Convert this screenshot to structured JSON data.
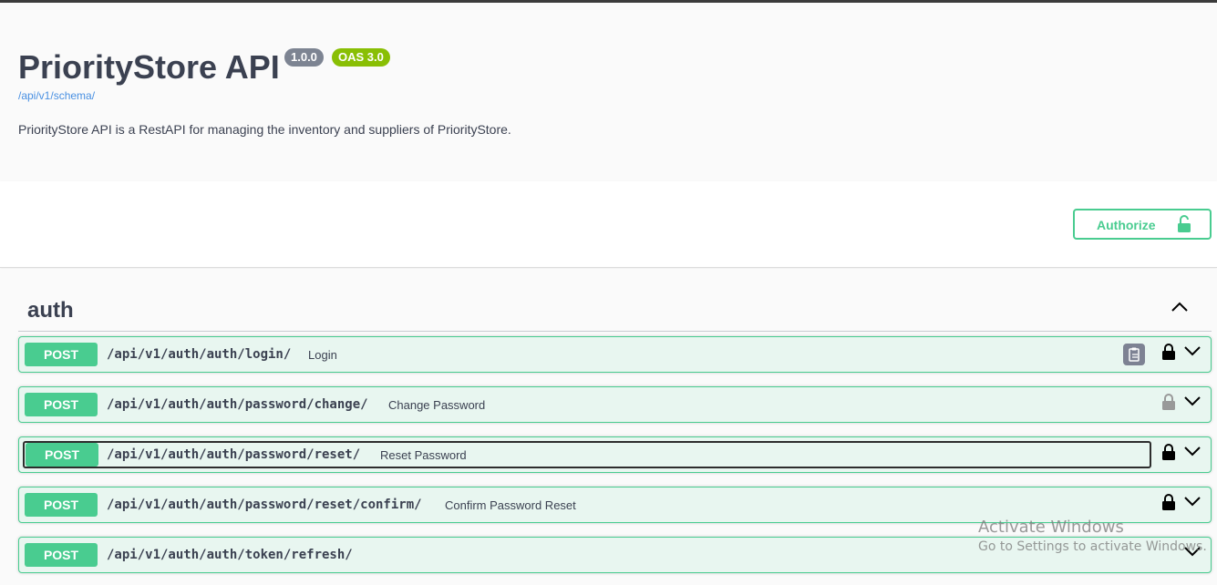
{
  "info": {
    "title": "PriorityStore API",
    "version_badge": "1.0.0",
    "oas_badge": "OAS 3.0",
    "schema_link": "/api/v1/schema/",
    "description": "PriorityStore API is a RestAPI for managing the inventory and suppliers of PriorityStore."
  },
  "authorize": {
    "label": "Authorize",
    "icon": "unlock-icon"
  },
  "tag": {
    "name": "auth",
    "expanded": true
  },
  "operations": [
    {
      "method": "POST",
      "path": "/api/v1/auth/auth/login/",
      "summary": "Login",
      "locked": true
    },
    {
      "method": "POST",
      "path": "/api/v1/auth/auth/password/change/",
      "summary": "Change Password",
      "locked": true
    },
    {
      "method": "POST",
      "path": "/api/v1/auth/auth/password/reset/",
      "summary": "Reset Password",
      "locked": true
    },
    {
      "method": "POST",
      "path": "/api/v1/auth/auth/password/reset/confirm/",
      "summary": "Confirm Password Reset",
      "locked": true
    },
    {
      "method": "POST",
      "path": "/api/v1/auth/auth/token/refresh/",
      "summary": "",
      "locked": false
    }
  ],
  "colors": {
    "post": "#49cc90",
    "post_bg": "#e8f6f0",
    "text": "#3b4151",
    "link": "#4990e2",
    "badge_gray": "#7d8492",
    "badge_green": "#89bf04"
  },
  "watermark": {
    "line1": "Activate Windows",
    "line2": "Go to Settings to activate Windows."
  }
}
